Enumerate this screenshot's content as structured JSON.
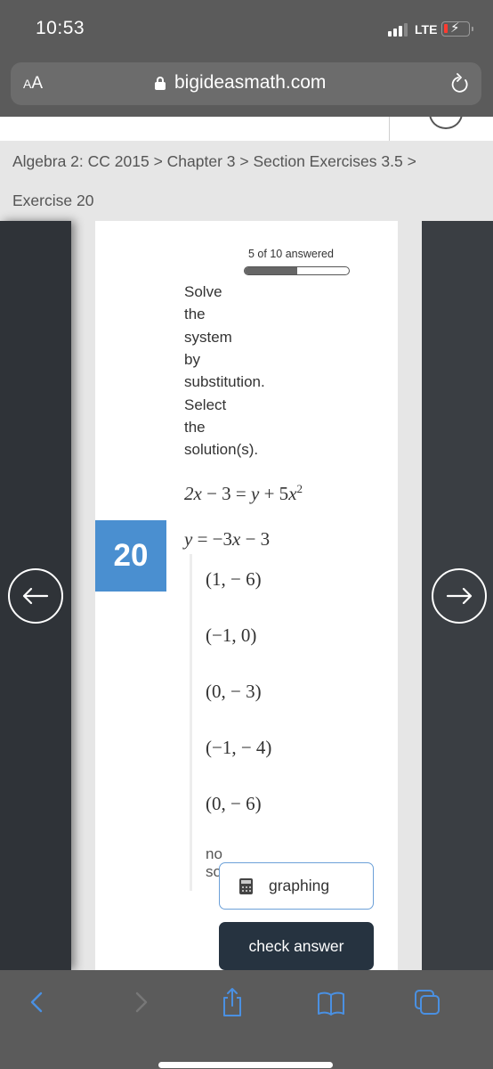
{
  "status_bar": {
    "time": "10:53",
    "network": "LTE",
    "battery_icon": "battery-charging-icon",
    "signal_bars": 3,
    "signal_bars_total": 4
  },
  "browser": {
    "text_size_label_small": "A",
    "text_size_label_large": "A",
    "url": "bigideasmath.com",
    "lock_icon": "lock-icon",
    "reload_icon": "reload-icon"
  },
  "breadcrumb": {
    "path": "Algebra 2: CC 2015 > Chapter 3 > Section Exercises 3.5 >",
    "current": "Exercise 20"
  },
  "progress": {
    "label": "5 of 10 answered",
    "answered": 5,
    "total": 10,
    "fraction": 0.5
  },
  "question": {
    "number": "20",
    "instruction_words": [
      "Solve",
      "the",
      "system",
      "by",
      "substitution.",
      "Select",
      "the",
      "solution(s)."
    ],
    "equations": [
      "2x − 3 = y + 5x²",
      "y = −3x − 3"
    ]
  },
  "options": [
    {
      "label": "(1,  − 6)"
    },
    {
      "label": "(−1, 0)"
    },
    {
      "label": "(0,  − 3)"
    },
    {
      "label": "(−1,  − 4)"
    },
    {
      "label": "(0,  − 6)"
    },
    {
      "label_line1": "no",
      "label_line2": "solution"
    }
  ],
  "buttons": {
    "graphing": "graphing",
    "check_answer": "check answer",
    "prev_icon": "arrow-left-icon",
    "next_icon": "arrow-right-icon"
  },
  "toolbar": {
    "items": [
      "back",
      "forward",
      "share",
      "bookmarks",
      "tabs"
    ],
    "accent_color": "#4a90e2"
  }
}
